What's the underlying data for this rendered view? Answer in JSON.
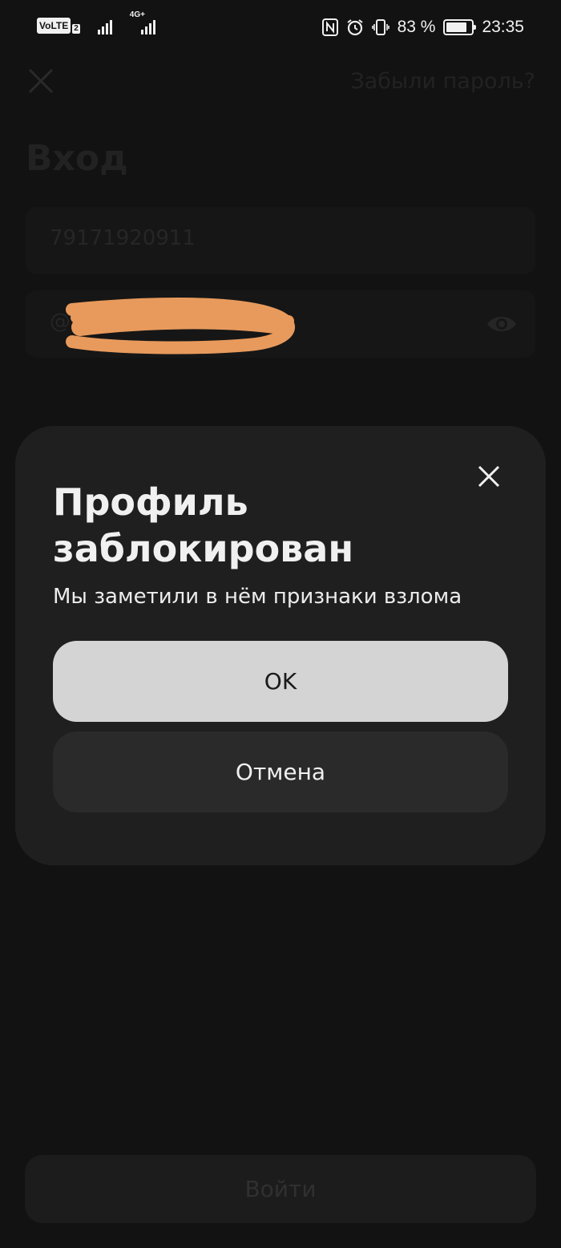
{
  "status_bar": {
    "volte_label": "VoLTE",
    "sim_label": "2",
    "network_label": "4G+",
    "battery_percent": "83 %",
    "time": "23:35"
  },
  "login_page": {
    "forgot_password": "Забыли пароль?",
    "title": "Вход",
    "phone_value": "79171920911",
    "password_prefix": "@",
    "login_button": "Войти"
  },
  "modal": {
    "title": "Профиль заблокирован",
    "message": "Мы заметили в нём признаки взлома",
    "ok_button": "OK",
    "cancel_button": "Отмена"
  },
  "colors": {
    "background": "#121212",
    "modal_bg": "#1f1f1f",
    "ok_bg": "#d4d4d4",
    "cancel_bg": "#2a2a2a",
    "redaction": "#e89a5c"
  },
  "icons": {
    "status": [
      "nfc-icon",
      "alarm-icon",
      "vibrate-icon",
      "battery-saver-icon"
    ],
    "page": [
      "close-icon",
      "eye-icon"
    ]
  }
}
